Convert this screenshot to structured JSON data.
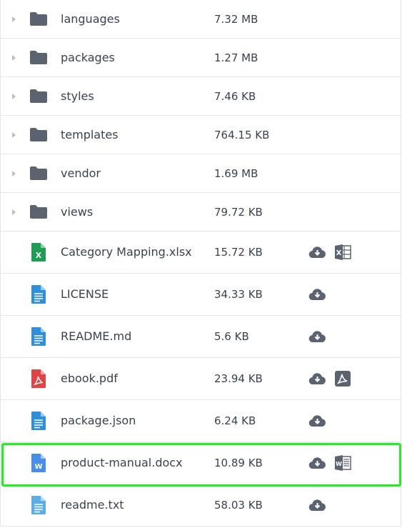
{
  "folders": [
    {
      "name": "languages",
      "size": "7.32 MB"
    },
    {
      "name": "packages",
      "size": "1.27 MB"
    },
    {
      "name": "styles",
      "size": "7.46 KB"
    },
    {
      "name": "templates",
      "size": "764.15 KB"
    },
    {
      "name": "vendor",
      "size": "1.69 MB"
    },
    {
      "name": "views",
      "size": "79.72 KB"
    }
  ],
  "files": [
    {
      "name": "Category Mapping.xlsx",
      "size": "15.72 KB",
      "icon": "excel-file-icon",
      "app_icon": "excel-app-icon"
    },
    {
      "name": "LICENSE",
      "size": "34.33 KB",
      "icon": "text-file-icon"
    },
    {
      "name": "README.md",
      "size": "5.6 KB",
      "icon": "text-file-icon"
    },
    {
      "name": "ebook.pdf",
      "size": "23.94 KB",
      "icon": "pdf-file-icon",
      "app_icon": "pdf-app-icon"
    },
    {
      "name": "package.json",
      "size": "6.24 KB",
      "icon": "text-file-icon"
    },
    {
      "name": "product-manual.docx",
      "size": "10.89 KB",
      "icon": "word-file-icon",
      "app_icon": "word-app-icon",
      "selected": true
    },
    {
      "name": "readme.txt",
      "size": "58.03 KB",
      "icon": "text-file-icon"
    }
  ],
  "colors": {
    "folder": "#5c6370",
    "excel": "#1f9d55",
    "text": "#2f8fd8",
    "pdf": "#e04545",
    "word": "#4a8fe7",
    "action": "#5c6370",
    "highlight": "#22ee22"
  }
}
